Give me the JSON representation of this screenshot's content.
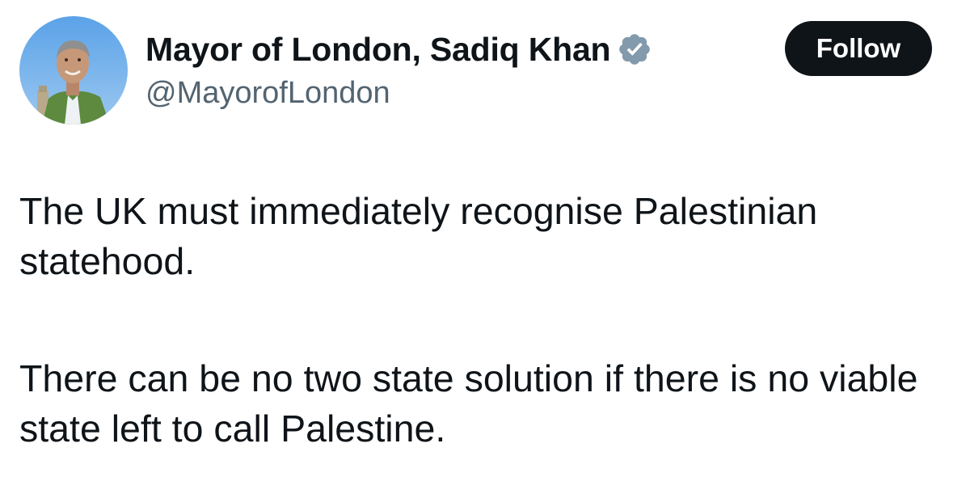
{
  "tweet": {
    "author": {
      "display_name": "Mayor of London, Sadiq Khan",
      "handle": "@MayorofLondon",
      "verified": true,
      "verified_icon": "verified-badge-icon",
      "avatar": "avatar-photo"
    },
    "follow_label": "Follow",
    "paragraphs": [
      "The UK must immediately recognise Palestinian statehood.",
      "There can be no two state solution if there is no viable state left to call Palestine."
    ]
  },
  "colors": {
    "text": "#0f1419",
    "secondary_text": "#536471",
    "follow_button_bg": "#0f1419",
    "follow_button_text": "#ffffff",
    "verified_badge": "#829aab",
    "background": "#ffffff"
  }
}
